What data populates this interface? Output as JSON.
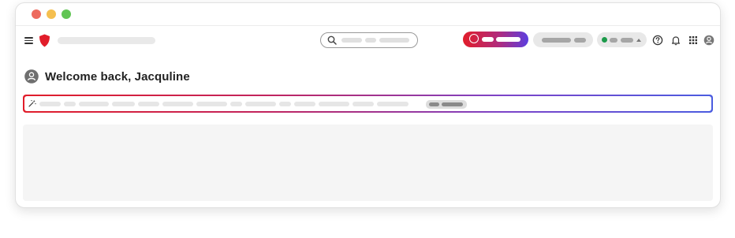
{
  "window": {
    "traffic_lights": [
      "close",
      "minimize",
      "zoom"
    ]
  },
  "topnav": {
    "menu_icon": "hamburger-icon",
    "logo_icon": "shield-logo-icon",
    "search": {
      "icon": "search-icon"
    },
    "ai_button": {
      "icon": "ring-icon"
    },
    "status_dropdown": {
      "status_color": "#1c9a4a",
      "icon": "caret-up-icon"
    },
    "icons": [
      "help-icon",
      "bell-icon",
      "app-grid-icon",
      "user-avatar-icon"
    ]
  },
  "main": {
    "greeting": "Welcome back, Jacquline",
    "greeting_avatar": "user-avatar-icon",
    "prompt": {
      "icon": "sparkle-icon"
    }
  },
  "colors": {
    "brand_red": "#e11d2a",
    "gradient_end": "#5b3ee0",
    "placeholder_gray": "#e6e6e6",
    "panel_bg": "#f5f5f5"
  }
}
